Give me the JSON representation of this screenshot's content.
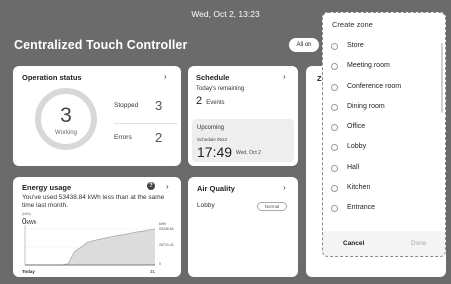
{
  "status_bar": {
    "datetime": "Wed, Oct 2, 13:23"
  },
  "header": {
    "title": "Centralized Touch Controller",
    "all_on_label": "All on"
  },
  "operation_status": {
    "title": "Operation status",
    "working_count": "3",
    "working_label": "Working",
    "stopped_label": "Stopped",
    "stopped_count": "3",
    "errors_label": "Errors",
    "errors_count": "2"
  },
  "schedule": {
    "title": "Schedule",
    "remaining_label": "Today's remaining",
    "remaining_count": "2",
    "events_label": "Events",
    "upcoming_label": "Upcoming",
    "upcoming_name": "Schedule 0623",
    "upcoming_time": "17:49",
    "upcoming_date": "Wed, Oct 2"
  },
  "energy": {
    "title": "Energy usage",
    "description": "You've used 53438.84 kWh less than at the same time last month.",
    "unit_top": "(kWh)",
    "current_value": "0",
    "current_unit": "kWh",
    "x_start": "Today",
    "x_end": "31"
  },
  "air_quality": {
    "title": "Air Quality",
    "room": "Lobby",
    "status": "Normal"
  },
  "zone_card": {
    "title_initial": "Z"
  },
  "create_zone": {
    "title": "Create zone",
    "options": [
      "Store",
      "Meeting room",
      "Conference room",
      "Dining room",
      "Office",
      "Lobby",
      "Hall",
      "Kitchen",
      "Entrance"
    ],
    "cancel_label": "Cancel",
    "done_label": "Done"
  },
  "chart_data": {
    "type": "area",
    "title": "Energy usage",
    "xlabel": "",
    "ylabel": "kWh",
    "x_labels": [
      "Today",
      "31"
    ],
    "y_ticks": [
      "53438.84",
      "26719.42",
      "0"
    ],
    "ylim": [
      0,
      53438.84
    ],
    "series": [
      {
        "values": [
          0,
          0,
          0,
          0,
          0,
          0,
          0,
          2000,
          20000,
          26000,
          33000,
          36000,
          38000,
          40000,
          42000,
          44000,
          45000,
          47000,
          49000,
          50000,
          52000,
          53438.84
        ]
      }
    ]
  },
  "colors": {
    "background": "#6b6b6b",
    "card": "#ffffff",
    "accent_line": "#9a9a9a"
  }
}
